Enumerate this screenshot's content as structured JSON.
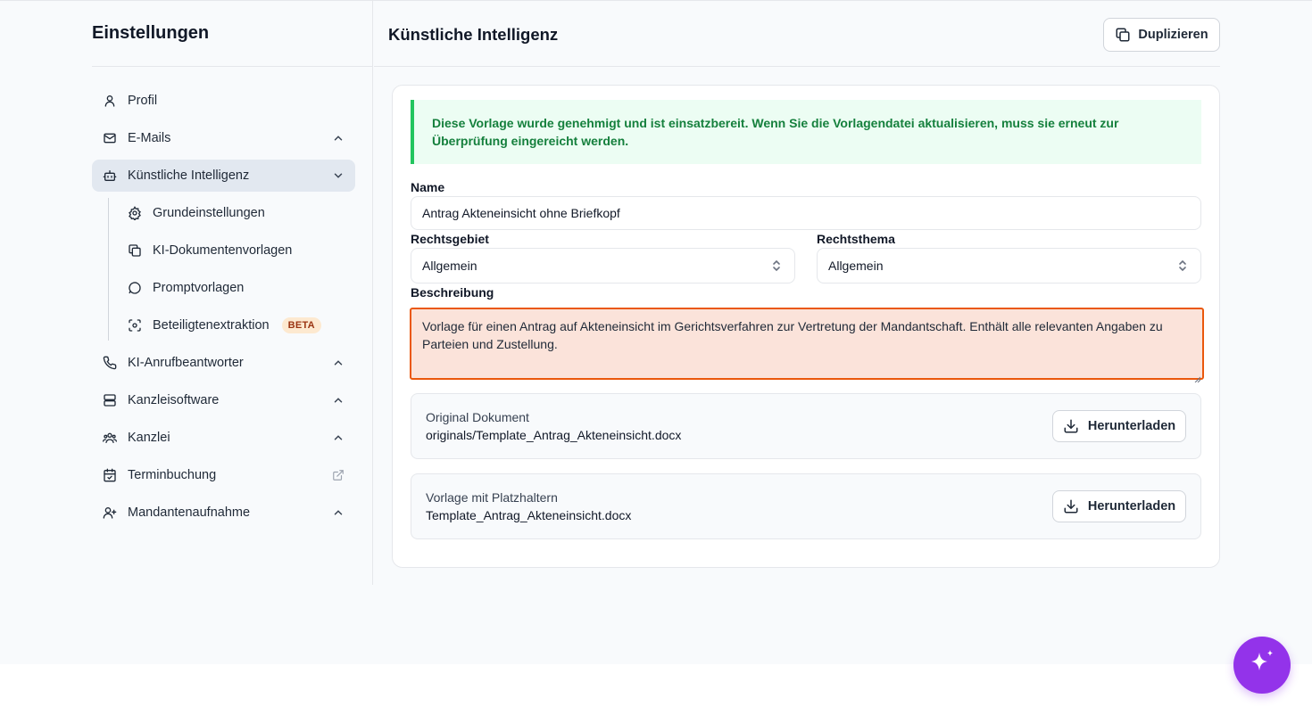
{
  "sidebar": {
    "title": "Einstellungen",
    "items": [
      {
        "label": "Profil",
        "icon": "user-icon"
      },
      {
        "label": "E-Mails",
        "icon": "mail-icon"
      },
      {
        "label": "Künstliche Intelligenz",
        "icon": "bot-icon",
        "active": true
      },
      {
        "label": "KI-Anrufbeantworter",
        "icon": "phone-icon"
      },
      {
        "label": "Kanzleisoftware",
        "icon": "server-icon"
      },
      {
        "label": "Kanzlei",
        "icon": "users-icon"
      },
      {
        "label": "Terminbuchung",
        "icon": "calendar-check-icon"
      },
      {
        "label": "Mandantenaufnahme",
        "icon": "user-plus-icon"
      }
    ],
    "subitems": [
      {
        "label": "Grundeinstellungen",
        "icon": "gear-icon"
      },
      {
        "label": "KI-Dokumentenvorlagen",
        "icon": "copy-icon"
      },
      {
        "label": "Promptvorlagen",
        "icon": "message-circle-icon"
      },
      {
        "label": "Beteiligtenextraktion",
        "icon": "scan-face-icon",
        "badge": "BETA"
      }
    ]
  },
  "main": {
    "title": "Künstliche Intelligenz",
    "duplicate_label": "Duplizieren",
    "alert": "Diese Vorlage wurde genehmigt und ist einsatzbereit. Wenn Sie die Vorlagendatei aktualisieren, muss sie erneut zur Überprüfung eingereicht werden.",
    "name_label": "Name",
    "name_value": "Antrag Akteneinsicht ohne Briefkopf",
    "rechtsgebiet_label": "Rechtsgebiet",
    "rechtsgebiet_value": "Allgemein",
    "rechtsthema_label": "Rechtsthema",
    "rechtsthema_value": "Allgemein",
    "beschreibung_label": "Beschreibung",
    "beschreibung_value": "Vorlage für einen Antrag auf Akteneinsicht im Gerichtsverfahren zur Vertretung der Mandantschaft. Enthält alle relevanten Angaben zu Parteien und Zustellung.",
    "files": [
      {
        "title": "Original Dokument",
        "name": "originals/Template_Antrag_Akteneinsicht.docx",
        "button": "Herunterladen"
      },
      {
        "title": "Vorlage mit Platzhaltern",
        "name": "Template_Antrag_Akteneinsicht.docx",
        "button": "Herunterladen"
      }
    ]
  },
  "colors": {
    "accent_purple": "#9333ea",
    "alert_green": "#15803d",
    "error_orange": "#ea580c"
  }
}
